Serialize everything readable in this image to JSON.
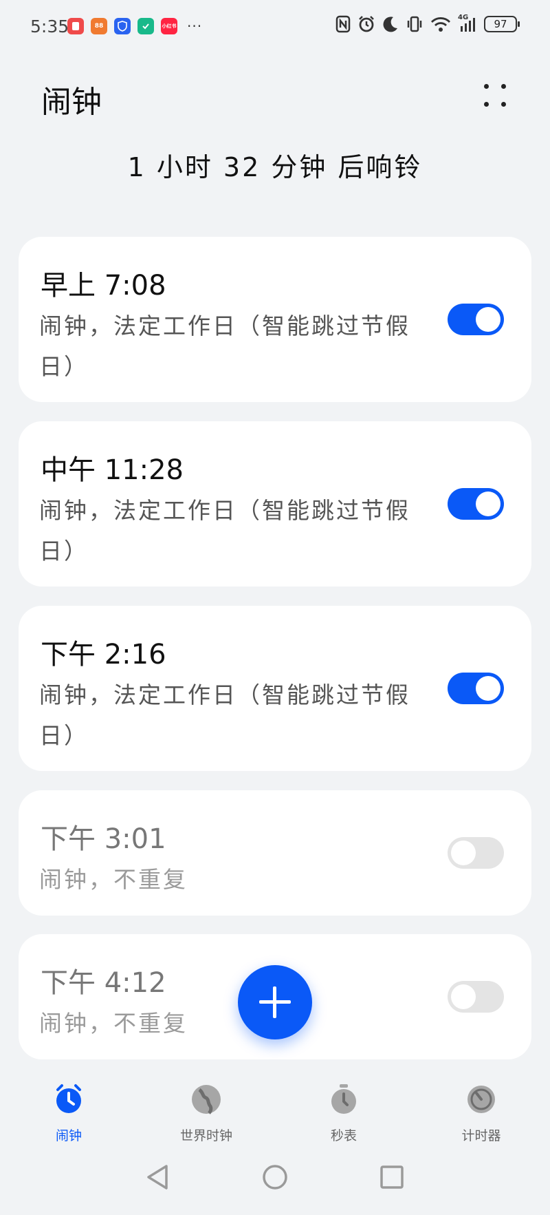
{
  "status_bar": {
    "time": "5:35",
    "apps": [
      {
        "icon": "red-app-icon",
        "color": "#ef4a4a",
        "text": ""
      },
      {
        "icon": "orange-app-icon",
        "color": "#f07a30",
        "text": "88"
      },
      {
        "icon": "blue-shield-app-icon",
        "color": "#2a63f0",
        "text": ""
      },
      {
        "icon": "green-app-icon",
        "color": "#18b98a",
        "text": ""
      },
      {
        "icon": "xiaohongshu-app-icon",
        "color": "#ff2442",
        "text": "小红书"
      }
    ],
    "more": "···",
    "network": "4G",
    "battery": "97"
  },
  "header": {
    "title": "闹钟",
    "more_icon": "more-dots-icon"
  },
  "countdown": "1 小时 32 分钟 后响铃",
  "alarms": [
    {
      "time": "早上 7:08",
      "desc": "闹钟，法定工作日（智能跳过节假日）",
      "enabled": true
    },
    {
      "time": "中午 11:28",
      "desc": "闹钟，法定工作日（智能跳过节假日）",
      "enabled": true
    },
    {
      "time": "下午 2:16",
      "desc": "闹钟，法定工作日（智能跳过节假日）",
      "enabled": true
    },
    {
      "time": "下午 3:01",
      "desc": "闹钟，不重复",
      "enabled": false
    },
    {
      "time": "下午 4:12",
      "desc": "闹钟，不重复",
      "enabled": false
    }
  ],
  "fab_icon": "plus-icon",
  "tabs": [
    {
      "label": "闹钟",
      "icon": "alarm-clock-icon",
      "active": true
    },
    {
      "label": "世界时钟",
      "icon": "globe-icon",
      "active": false
    },
    {
      "label": "秒表",
      "icon": "stopwatch-icon",
      "active": false
    },
    {
      "label": "计时器",
      "icon": "timer-icon",
      "active": false
    }
  ],
  "colors": {
    "accent": "#0a59f7",
    "background": "#f1f3f5",
    "card": "#ffffff",
    "inactive_icon": "#9e9e9e",
    "toggle_off": "#e4e4e4"
  }
}
